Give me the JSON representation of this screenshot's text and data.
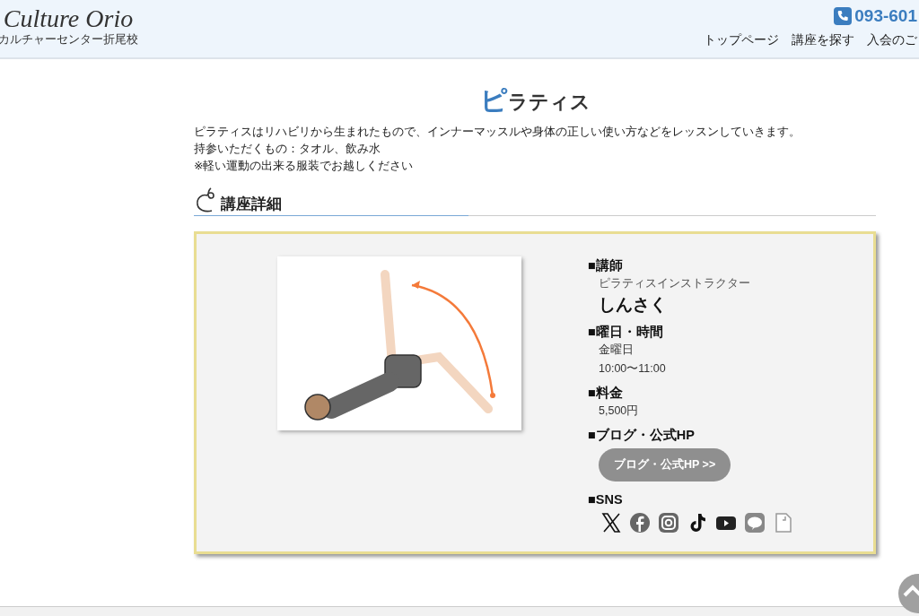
{
  "header": {
    "logo_title": "Culture Orio",
    "logo_subtitle": "カルチャーセンター折尾校",
    "phone": "093-601",
    "nav": [
      "トップページ",
      "講座を探す",
      "入会のご"
    ]
  },
  "page": {
    "title_accent": "ピ",
    "title_rest": "ラティス",
    "description": [
      "ピラティスはリハビリから生まれたもので、インナーマッスルや身体の正しい使い方などをレッスンしていきます。",
      "持参いただくもの：タオル、飲み水",
      "※軽い運動の出来る服装でお越しください"
    ],
    "section_heading": "講座詳細"
  },
  "details": [
    {
      "kind": "instructor",
      "heading": "■講師",
      "role": "ピラティスインストラクター",
      "name": "しんさく"
    },
    {
      "kind": "lines",
      "heading": "■曜日・時間",
      "lines": [
        "金曜日",
        "10:00〜11:00"
      ]
    },
    {
      "kind": "lines",
      "heading": "■料金",
      "lines": [
        "5,500円"
      ]
    },
    {
      "kind": "button",
      "heading": "■ブログ・公式HP",
      "button": "ブログ・公式HP >>"
    },
    {
      "kind": "sns",
      "heading": "■SNS"
    }
  ]
}
